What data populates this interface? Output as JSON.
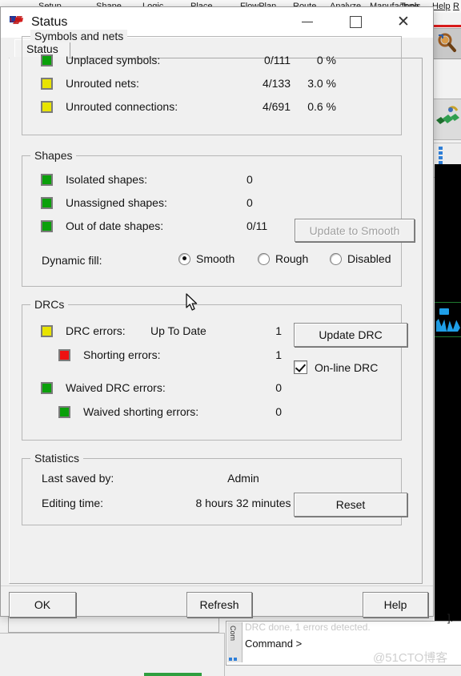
{
  "window": {
    "title": "Status",
    "app_icon": "allegro-logo-icon",
    "minimize_label": "Minimize",
    "maximize_label": "Maximize",
    "close_label": "Close"
  },
  "tabs": [
    {
      "label": "Status",
      "selected": true
    }
  ],
  "groups": {
    "symbols_and_nets": {
      "title": "Symbols and nets",
      "rows": [
        {
          "status_color": "#0aa00a",
          "label": "Unplaced symbols:",
          "count": "0/111",
          "percent": "0 %"
        },
        {
          "status_color": "#e8e400",
          "label": "Unrouted nets:",
          "count": "4/133",
          "percent": "3.0 %"
        },
        {
          "status_color": "#e8e400",
          "label": "Unrouted connections:",
          "count": "4/691",
          "percent": "0.6 %"
        }
      ]
    },
    "shapes": {
      "title": "Shapes",
      "rows": [
        {
          "status_color": "#0aa00a",
          "label": "Isolated shapes:",
          "count": "0"
        },
        {
          "status_color": "#0aa00a",
          "label": "Unassigned shapes:",
          "count": "0"
        },
        {
          "status_color": "#0aa00a",
          "label": "Out of date shapes:",
          "count": "0/11"
        }
      ],
      "update_to_smooth_label": "Update to Smooth",
      "update_to_smooth_enabled": false,
      "dynamic_fill_label": "Dynamic fill:",
      "dynamic_fill_options": [
        {
          "label": "Smooth",
          "selected": true
        },
        {
          "label": "Rough",
          "selected": false
        },
        {
          "label": "Disabled",
          "selected": false
        }
      ]
    },
    "drcs": {
      "title": "DRCs",
      "rows": [
        {
          "status_color": "#e8e400",
          "label": "DRC errors:",
          "extra": "Up To Date",
          "count": "1",
          "indent": 0
        },
        {
          "status_color": "#ee1111",
          "label": "Shorting errors:",
          "extra": "",
          "count": "1",
          "indent": 1
        },
        {
          "status_color": "#0aa00a",
          "label": "Waived DRC errors:",
          "extra": "",
          "count": "0",
          "indent": 0
        },
        {
          "status_color": "#0aa00a",
          "label": "Waived shorting errors:",
          "extra": "",
          "count": "0",
          "indent": 1
        }
      ],
      "update_drc_label": "Update DRC",
      "online_drc_label": "On-line DRC",
      "online_drc_checked": true
    },
    "statistics": {
      "title": "Statistics",
      "rows": [
        {
          "label": "Last saved by:",
          "value": "Admin"
        },
        {
          "label": "Editing time:",
          "value": "8 hours 32 minutes"
        }
      ],
      "reset_label": "Reset"
    }
  },
  "footer": {
    "ok_label": "OK",
    "refresh_label": "Refresh",
    "help_label": "Help"
  },
  "background": {
    "menubar_items": [
      "Setup",
      "Shape",
      "Logic",
      "Place",
      "FlowPlan",
      "Route",
      "Analyze",
      "Manufacture",
      "Tools",
      "Help",
      "R"
    ],
    "command_panel_tab": "Com",
    "command_log_line": "DRC done, 1 errors detected.",
    "command_prompt": "Command >",
    "brace": "].",
    "watermark": "@51CTO博客"
  }
}
